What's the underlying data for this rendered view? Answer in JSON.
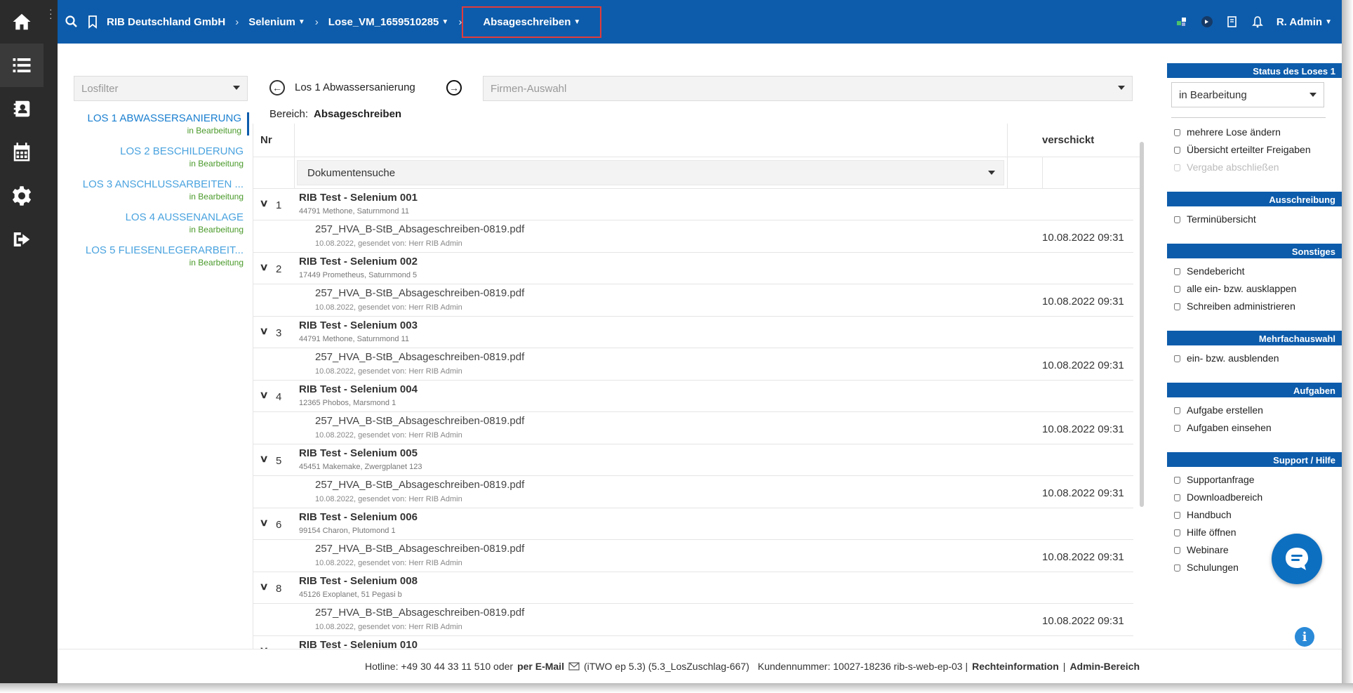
{
  "breadcrumb": {
    "items": [
      "RIB Deutschland GmbH",
      "Selenium",
      "Lose_VM_1659510285",
      "Absageschreiben"
    ]
  },
  "user": {
    "name": "R. Admin"
  },
  "losfilter": {
    "placeholder": "Losfilter"
  },
  "lose": [
    {
      "name": "LOS 1 ABWASSERSANIERUNG",
      "status": "in Bearbeitung"
    },
    {
      "name": "LOS 2 BESCHILDERUNG",
      "status": "in Bearbeitung"
    },
    {
      "name": "LOS 3 ANSCHLUSSARBEITEN ...",
      "status": "in Bearbeitung"
    },
    {
      "name": "LOS 4 AUSSENANLAGE",
      "status": "in Bearbeitung"
    },
    {
      "name": "LOS 5 FLIESENLEGERARBEIT...",
      "status": "in Bearbeitung"
    }
  ],
  "current_los": "Los 1 Abwassersanierung",
  "bereich": {
    "label": "Bereich:",
    "value": "Absageschreiben"
  },
  "firmen": {
    "placeholder": "Firmen-Auswahl"
  },
  "table": {
    "col_nr": "Nr",
    "col_verschickt": "verschickt",
    "docsearch": "Dokumentensuche",
    "groups": [
      {
        "nr": "1",
        "firm": "RIB Test - Selenium 001",
        "addr": "44791 Methone, Saturnmond 11",
        "file": "257_HVA_B-StB_Absageschreiben-0819.pdf",
        "meta": "10.08.2022, gesendet von: Herr RIB Admin",
        "date": "10.08.2022 09:31"
      },
      {
        "nr": "2",
        "firm": "RIB Test - Selenium 002",
        "addr": "17449 Prometheus, Saturnmond 5",
        "file": "257_HVA_B-StB_Absageschreiben-0819.pdf",
        "meta": "10.08.2022, gesendet von: Herr RIB Admin",
        "date": "10.08.2022 09:31"
      },
      {
        "nr": "3",
        "firm": "RIB Test - Selenium 003",
        "addr": "44791 Methone, Saturnmond 11",
        "file": "257_HVA_B-StB_Absageschreiben-0819.pdf",
        "meta": "10.08.2022, gesendet von: Herr RIB Admin",
        "date": "10.08.2022 09:31"
      },
      {
        "nr": "4",
        "firm": "RIB Test - Selenium 004",
        "addr": "12365 Phobos, Marsmond 1",
        "file": "257_HVA_B-StB_Absageschreiben-0819.pdf",
        "meta": "10.08.2022, gesendet von: Herr RIB Admin",
        "date": "10.08.2022 09:31"
      },
      {
        "nr": "5",
        "firm": "RIB Test - Selenium 005",
        "addr": "45451 Makemake, Zwergplanet 123",
        "file": "257_HVA_B-StB_Absageschreiben-0819.pdf",
        "meta": "10.08.2022, gesendet von: Herr RIB Admin",
        "date": "10.08.2022 09:31"
      },
      {
        "nr": "6",
        "firm": "RIB Test - Selenium 006",
        "addr": "99154 Charon, Plutomond 1",
        "file": "257_HVA_B-StB_Absageschreiben-0819.pdf",
        "meta": "10.08.2022, gesendet von: Herr RIB Admin",
        "date": "10.08.2022 09:31"
      },
      {
        "nr": "8",
        "firm": "RIB Test - Selenium 008",
        "addr": "45126 Exoplanet, 51 Pegasi b",
        "file": "257_HVA_B-StB_Absageschreiben-0819.pdf",
        "meta": "10.08.2022, gesendet von: Herr RIB Admin",
        "date": "10.08.2022 09:31"
      },
      {
        "nr": "",
        "firm": "RIB Test - Selenium 010",
        "addr": "",
        "file": "",
        "meta": "",
        "date": ""
      }
    ]
  },
  "right_panel": {
    "status_header": "Status des Loses 1",
    "status_value": "in Bearbeitung",
    "status_links": [
      "mehrere Lose ändern",
      "Übersicht erteilter Freigaben",
      "Vergabe abschließen"
    ],
    "ausschreibung_header": "Ausschreibung",
    "ausschreibung_links": [
      "Terminübersicht"
    ],
    "sonstiges_header": "Sonstiges",
    "sonstiges_links": [
      "Sendebericht",
      "alle ein- bzw. ausklappen",
      "Schreiben administrieren"
    ],
    "mehrfach_header": "Mehrfachauswahl",
    "mehrfach_links": [
      "ein- bzw. ausblenden"
    ],
    "aufgaben_header": "Aufgaben",
    "aufgaben_links": [
      "Aufgabe erstellen",
      "Aufgaben einsehen"
    ],
    "support_header": "Support / Hilfe",
    "support_links": [
      "Supportanfrage",
      "Downloadbereich",
      "Handbuch",
      "Hilfe öffnen",
      "Webinare",
      "Schulungen"
    ]
  },
  "footer": {
    "hotline": "Hotline: +49 30 44 33 11 510 oder",
    "email": "per E-Mail",
    "version": "(iTWO ep 5.3) (5.3_LosZuschlag-667)",
    "kunde": "Kundennummer: 10027-18236 rib-s-web-ep-03 |",
    "recht": "Rechteinformation",
    "divider": "|",
    "admin": "Admin-Bereich"
  },
  "colors": {
    "primary": "#0d5cab",
    "rail": "#2b2b2b",
    "status_green": "#4a9a2a",
    "los_link": "#4aa3df",
    "highlight_box": "#e23b3b"
  }
}
